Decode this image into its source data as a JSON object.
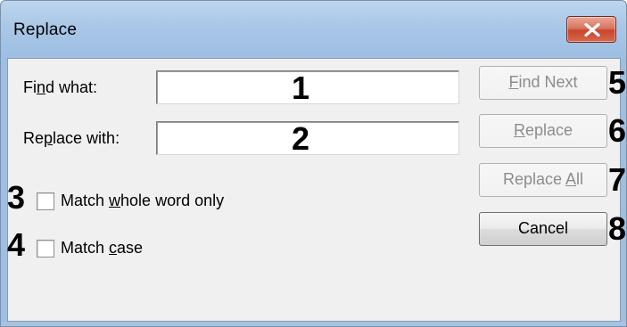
{
  "window": {
    "title": "Replace",
    "close_glyph": "✕"
  },
  "fields": {
    "find_label_pre": "Fi",
    "find_label_key": "n",
    "find_label_post": "d what:",
    "find_value": "",
    "replace_label_pre": "Re",
    "replace_label_key": "p",
    "replace_label_post": "lace with:",
    "replace_value": ""
  },
  "options": {
    "whole_word_pre": "Match ",
    "whole_word_key": "w",
    "whole_word_post": "hole word only",
    "whole_word_checked": false,
    "match_case_pre": "Match ",
    "match_case_key": "c",
    "match_case_post": "ase",
    "match_case_checked": false
  },
  "buttons": {
    "find_next_key": "F",
    "find_next_rest": "ind Next",
    "replace_key": "R",
    "replace_rest": "eplace",
    "replace_all_pre": "Replace ",
    "replace_all_key": "A",
    "replace_all_post": "ll",
    "cancel": "Cancel"
  },
  "annotations": [
    "1",
    "2",
    "3",
    "4",
    "5",
    "6",
    "7",
    "8"
  ],
  "colors": {
    "title_bar": "#a9c6e6",
    "close_button": "#c9452b",
    "dialog_face": "#f0f0f0",
    "disabled_text": "#8c8c8c"
  }
}
